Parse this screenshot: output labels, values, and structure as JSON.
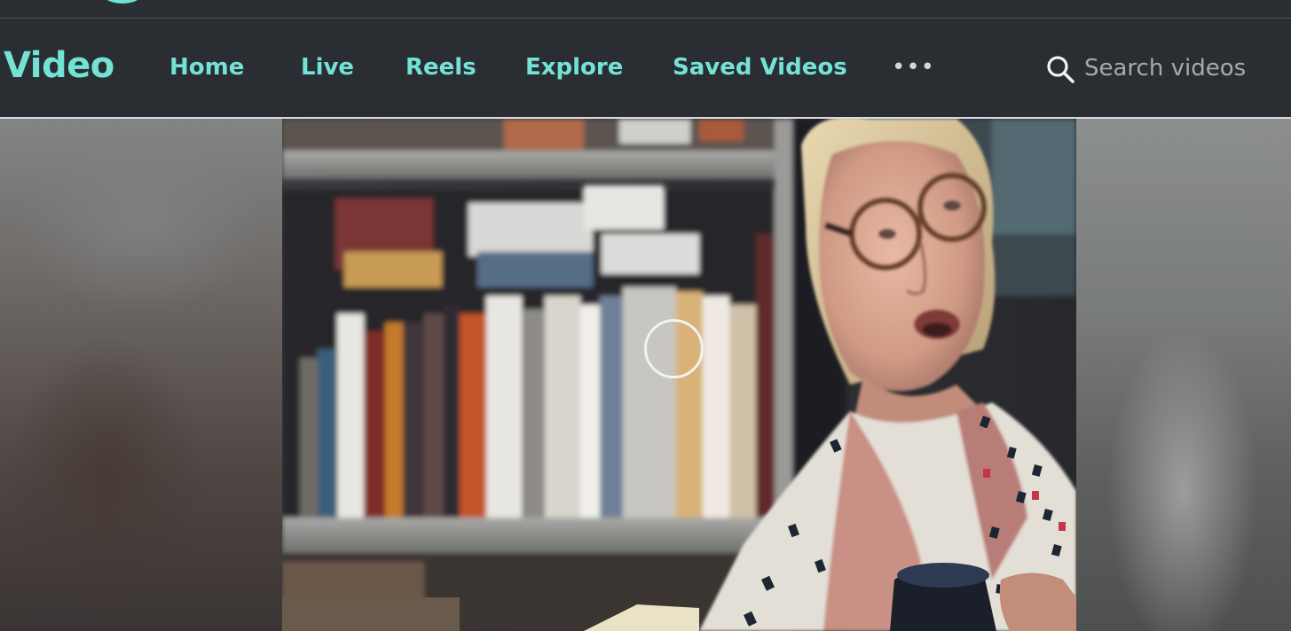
{
  "brand": {
    "name": "Video",
    "accent_color": "#74e3d5"
  },
  "nav": {
    "items": [
      {
        "label": "Home"
      },
      {
        "label": "Live"
      },
      {
        "label": "Reels"
      },
      {
        "label": "Explore"
      },
      {
        "label": "Saved Videos"
      }
    ],
    "more_icon": "more-horizontal-icon",
    "more_label": "•••"
  },
  "search": {
    "placeholder": "Search videos",
    "icon": "search-icon",
    "value": ""
  },
  "player": {
    "state_icon": "loading-spinner-icon",
    "scene": "woman-with-glasses-holding-mug-in-front-of-bookshelf"
  }
}
